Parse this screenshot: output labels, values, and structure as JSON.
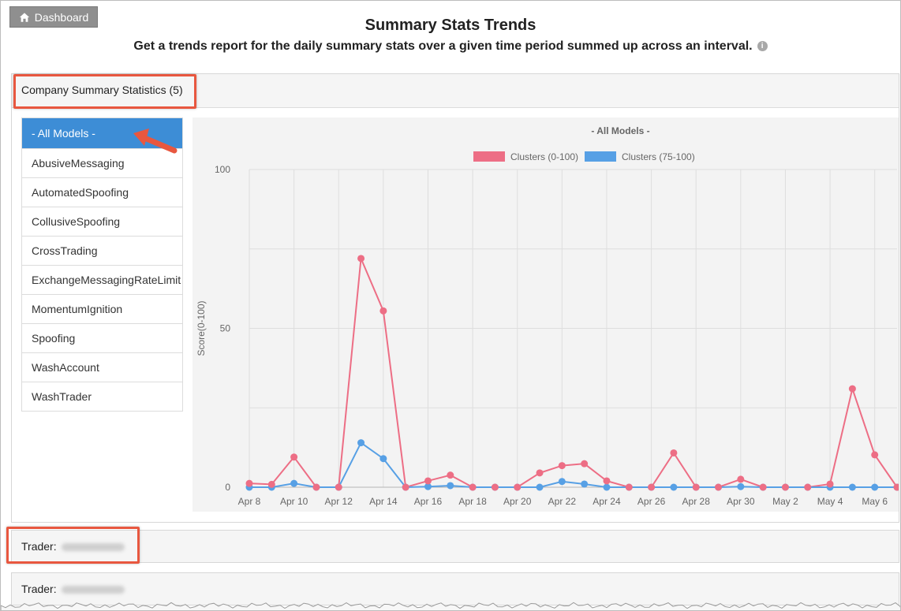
{
  "header": {
    "dashboard_label": "Dashboard",
    "title": "Summary Stats Trends",
    "subtitle": "Get a trends report for the daily summary stats over a given time period summed up across an interval.",
    "info_glyph": "i"
  },
  "panels": {
    "company": {
      "label": "Company Summary Statistics (5)"
    },
    "traders": [
      {
        "label": "Trader:"
      },
      {
        "label": "Trader:"
      }
    ]
  },
  "models": [
    "- All Models -",
    "AbusiveMessaging",
    "AutomatedSpoofing",
    "CollusiveSpoofing",
    "CrossTrading",
    "ExchangeMessagingRateLimit",
    "MomentumIgnition",
    "Spoofing",
    "WashAccount",
    "WashTrader"
  ],
  "selected_model_index": 0,
  "colors": {
    "accent": "#3d8dd6",
    "highlight": "#e8573f",
    "series_red": "#ed6e85",
    "series_blue": "#57a0e5"
  },
  "chart_data": {
    "type": "line",
    "title": "- All Models -",
    "ylabel": "Score(0-100)",
    "xlabel": "",
    "ylim": [
      0,
      100
    ],
    "yticks": [
      0,
      50,
      100
    ],
    "legend_position": "top",
    "grid": true,
    "x_tick_labels": [
      "Apr 8",
      "Apr 10",
      "Apr 12",
      "Apr 14",
      "Apr 16",
      "Apr 18",
      "Apr 20",
      "Apr 22",
      "Apr 24",
      "Apr 26",
      "Apr 28",
      "Apr 30",
      "May 2",
      "May 4",
      "May 6"
    ],
    "x": [
      "Apr 8",
      "Apr 9",
      "Apr 10",
      "Apr 11",
      "Apr 12",
      "Apr 13",
      "Apr 14",
      "Apr 15",
      "Apr 16",
      "Apr 17",
      "Apr 18",
      "Apr 19",
      "Apr 20",
      "Apr 21",
      "Apr 22",
      "Apr 23",
      "Apr 24",
      "Apr 25",
      "Apr 26",
      "Apr 27",
      "Apr 28",
      "Apr 29",
      "Apr 30",
      "May 1",
      "May 2",
      "May 3",
      "May 4",
      "May 5",
      "May 6",
      "May 7"
    ],
    "series": [
      {
        "name": "Clusters (0-100)",
        "color": "#ed6e85",
        "values": [
          1.2,
          0.9,
          9.5,
          0,
          0,
          72,
          55.5,
          0,
          2,
          3.8,
          0,
          0,
          0,
          4.5,
          6.8,
          7.4,
          2,
          0,
          0,
          10.8,
          0,
          0,
          2.5,
          0,
          0,
          0,
          1,
          31,
          10.2,
          0
        ]
      },
      {
        "name": "Clusters (75-100)",
        "color": "#57a0e5",
        "values": [
          0,
          0,
          1.2,
          0,
          0,
          14,
          9,
          0,
          0.2,
          0.5,
          0,
          0,
          0,
          0,
          1.8,
          1,
          0,
          0,
          0,
          0,
          0,
          0,
          0.2,
          0,
          0,
          0,
          0,
          0,
          0,
          0
        ]
      }
    ]
  }
}
